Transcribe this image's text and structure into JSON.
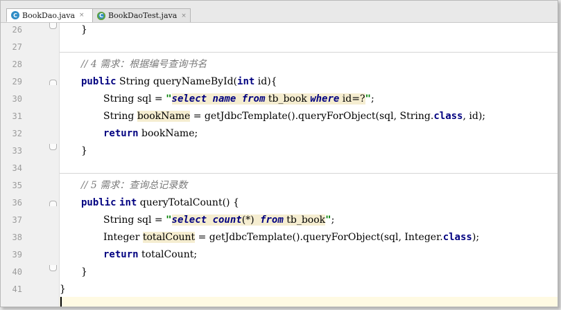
{
  "tabs": [
    {
      "label": "BookDao.java",
      "icon": "class-c-icon",
      "active": true
    },
    {
      "label": "BookDaoTest.java",
      "icon": "test-class-c-icon",
      "active": false
    }
  ],
  "icon_letter": "C",
  "close_glyph": "×",
  "line_numbers": [
    "26",
    "27",
    "28",
    "29",
    "30",
    "31",
    "32",
    "33",
    "34",
    "35",
    "36",
    "37",
    "38",
    "39",
    "40",
    "41"
  ],
  "code": {
    "l26_brace": "}",
    "l28_comment": "// 4 需求：根据编号查询书名",
    "l29_public": "public",
    "l29_rest": " String queryNameById(",
    "l29_int": "int",
    "l29_end": " id){",
    "l30_pre": "String sql = ",
    "l30_q1": "\"",
    "l30_sel": "select",
    "l30_sp1": " ",
    "l30_name": "name",
    "l30_sp2": " ",
    "l30_from": "from",
    "l30_tb": " tb_book ",
    "l30_where": "where",
    "l30_tail": " id=?",
    "l30_q2": "\"",
    "l30_semi": ";",
    "l31_pre": "String ",
    "l31_var": "bookName",
    "l31_mid": " = getJdbcTemplate().queryForObject(sql, String.",
    "l31_class": "class",
    "l31_end": ", id);",
    "l32_return": "return",
    "l32_rest": " bookName;",
    "l33_brace": "}",
    "l35_comment": "// 5 需求：查询总记录数",
    "l36_public": "public",
    "l36_sp": " ",
    "l36_int": "int",
    "l36_rest": " queryTotalCount() {",
    "l37_pre": "String sql = ",
    "l37_q1": "\"",
    "l37_sel": "select",
    "l37_sp1": " ",
    "l37_count": "count",
    "l37_paren": "(*)",
    "l37_sp2": " ",
    "l37_from": "from",
    "l37_tb": " tb_book",
    "l37_q2": "\"",
    "l37_semi": ";",
    "l38_pre": "Integer ",
    "l38_var": "totalCount",
    "l38_mid": " = getJdbcTemplate().queryForObject(sql, Integer.",
    "l38_class": "class",
    "l38_end": ");",
    "l39_return": "return",
    "l39_rest": " totalCount;",
    "l40_brace": "}",
    "l41_brace": "}"
  },
  "colors": {
    "keyword": "#000080",
    "string": "#008000",
    "comment": "#7a7a7a",
    "sql_background": "#f5edd0",
    "gutter": "#f0f0f0"
  }
}
